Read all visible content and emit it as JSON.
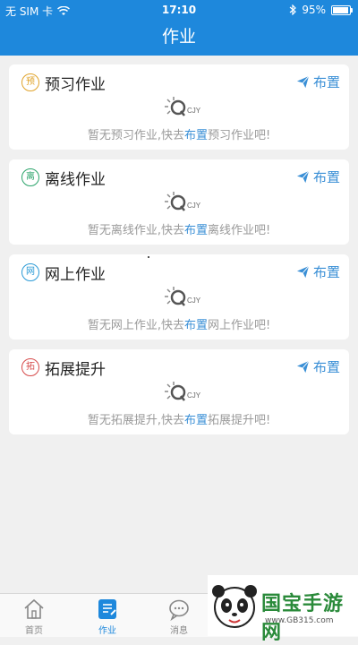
{
  "status": {
    "carrier": "无 SIM 卡",
    "time": "17:10",
    "battery": "95%",
    "battery_level": 0.95
  },
  "nav": {
    "title": "作业"
  },
  "cards": [
    {
      "badge": "预",
      "badge_color": "#e0a32a",
      "title": "预习作业",
      "assign": "布置",
      "empty_prefix": "暂无预习作业,快去",
      "empty_link": "布置",
      "empty_suffix": "预习作业吧!"
    },
    {
      "badge": "离",
      "badge_color": "#2aa36a",
      "title": "离线作业",
      "assign": "布置",
      "empty_prefix": "暂无离线作业,快去",
      "empty_link": "布置",
      "empty_suffix": "离线作业吧!"
    },
    {
      "badge": "网",
      "badge_color": "#2a9ad6",
      "title": "网上作业",
      "assign": "布置",
      "empty_prefix": "暂无网上作业,快去",
      "empty_link": "布置",
      "empty_suffix": "网上作业吧!"
    },
    {
      "badge": "拓",
      "badge_color": "#d64a4a",
      "title": "拓展提升",
      "assign": "布置",
      "empty_prefix": "暂无拓展提升,快去",
      "empty_link": "布置",
      "empty_suffix": "拓展提升吧!"
    }
  ],
  "logo": {
    "text": "CJY"
  },
  "tabs": [
    {
      "label": "首页",
      "icon": "home-icon"
    },
    {
      "label": "作业",
      "icon": "homework-icon",
      "active": true
    },
    {
      "label": "消息",
      "icon": "message-icon"
    }
  ],
  "watermark": {
    "title": "国宝手游网",
    "url": "www.GB315.com"
  },
  "colors": {
    "primary": "#1e88dc",
    "link": "#3a8fd6",
    "muted": "#9a9a9a"
  }
}
